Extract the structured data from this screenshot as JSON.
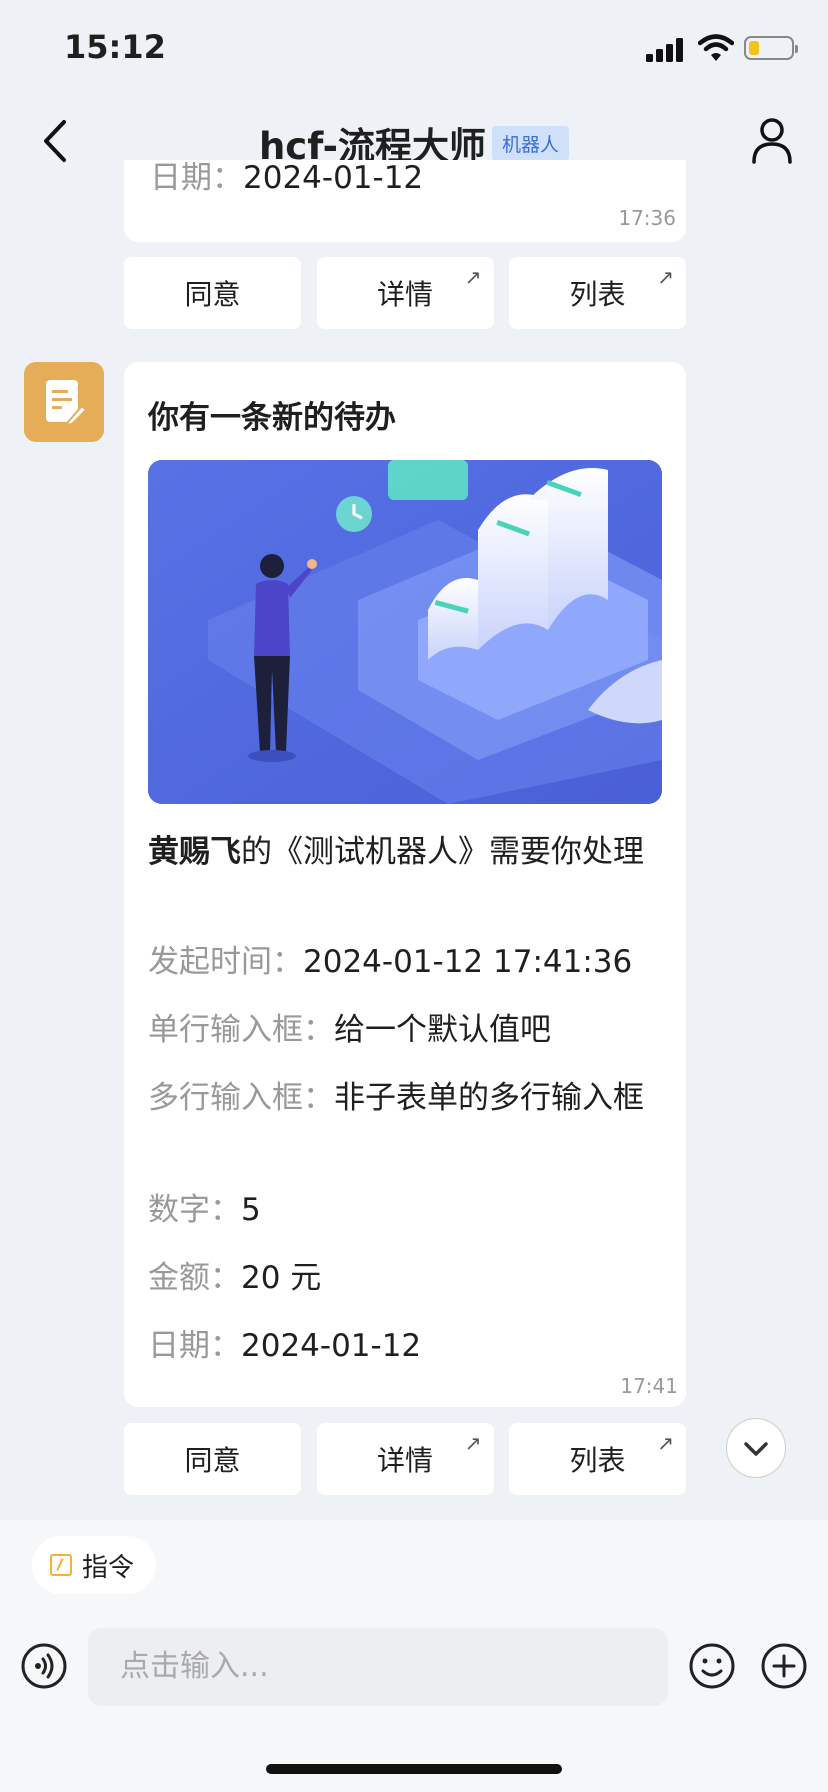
{
  "status_bar": {
    "time": "15:12"
  },
  "header": {
    "title": "hcf-流程大师",
    "tag": "机器人"
  },
  "prev_message": {
    "partial_label": "日期：",
    "partial_value": "2024-01-12",
    "time": "17:36"
  },
  "actions": [
    {
      "label": "同意"
    },
    {
      "label": "详情",
      "arrow": "↗"
    },
    {
      "label": "列表",
      "arrow": "↗"
    }
  ],
  "message": {
    "title": "你有一条新的待办",
    "headline_name": "黄赐飞",
    "headline_rest": "的《测试机器人》需要你处理",
    "fields": [
      {
        "label": "发起时间：",
        "value": "2024-01-12 17:41:36"
      },
      {
        "label": "单行输入框：",
        "value": "给一个默认值吧"
      },
      {
        "label": "多行输入框：",
        "value": "非子表单的多行输入框"
      },
      {
        "label": "数字：",
        "value": "5"
      },
      {
        "label": "金额：",
        "value": "20 元"
      },
      {
        "label": "日期：",
        "value": "2024-01-12"
      }
    ],
    "time": "17:41"
  },
  "composer": {
    "command_label": "指令",
    "placeholder": "点击输入..."
  },
  "colors": {
    "accent": "#e6ad58",
    "tag_bg": "#cfe0fb",
    "tag_text": "#3a6fd6"
  }
}
